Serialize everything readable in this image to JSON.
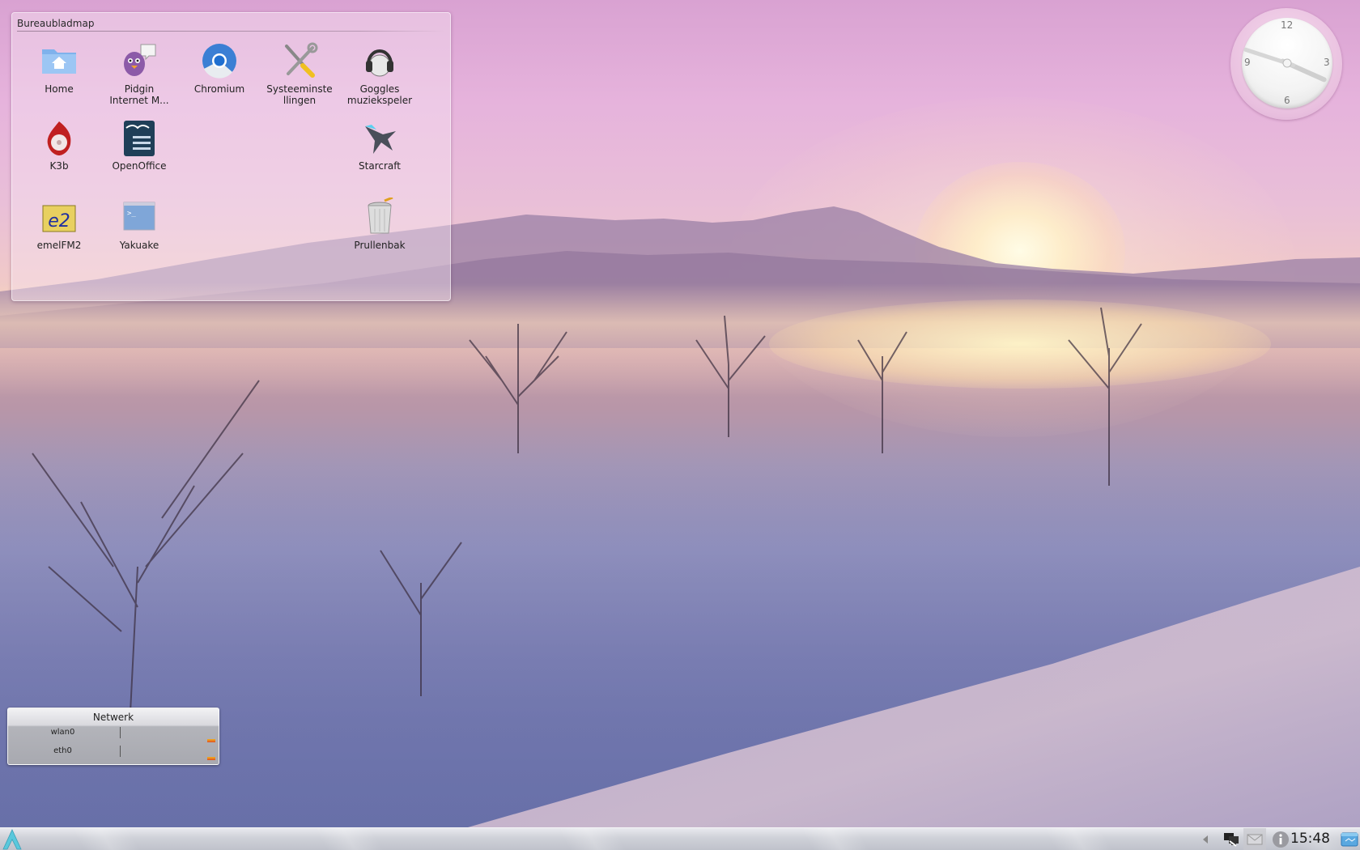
{
  "desktop": {
    "wallpaper": "winter-sunrise-landscape",
    "colors": {
      "sky_top": "#d9a2d2",
      "sun": "#fff8e0",
      "snow_shadow": "#6e76a8"
    }
  },
  "folderview": {
    "title": "Bureaubladmap",
    "icons": [
      {
        "label": "Home",
        "icon": "home-folder-icon"
      },
      {
        "label": "Pidgin\nInternet M...",
        "line1": "Pidgin",
        "line2": "Internet M...",
        "icon": "pidgin-icon"
      },
      {
        "label": "Chromium",
        "icon": "chromium-icon"
      },
      {
        "label": "Systeeminstellingen",
        "line1": "Systeeminste",
        "line2": "llingen",
        "icon": "settings-tools-icon"
      },
      {
        "label": "Goggles muziekspeler",
        "line1": "Goggles",
        "line2": "muziekspeler",
        "icon": "headphones-icon"
      },
      {
        "label": "K3b",
        "icon": "k3b-icon"
      },
      {
        "label": "OpenOffice",
        "icon": "openoffice-icon"
      },
      {
        "label": "Starcraft",
        "icon": "starcraft-icon"
      },
      {
        "label": "emelFM2",
        "icon": "emelfm2-icon"
      },
      {
        "label": "Yakuake",
        "icon": "terminal-icon"
      },
      {
        "label": "Prullenbak",
        "icon": "trash-icon"
      }
    ]
  },
  "analog_clock": {
    "numerals": [
      "12",
      "3",
      "6",
      "9"
    ],
    "hours": 15,
    "minutes": 48
  },
  "network_widget": {
    "title": "Netwerk",
    "interfaces": [
      {
        "name": "wlan0"
      },
      {
        "name": "eth0"
      }
    ]
  },
  "panel": {
    "launcher_icon": "arch-linux-icon",
    "tray": [
      {
        "name": "network-manager-icon"
      },
      {
        "name": "mail-icon"
      },
      {
        "name": "info-icon"
      }
    ],
    "time": "15:48",
    "show_desktop_icon": "show-desktop-icon"
  }
}
